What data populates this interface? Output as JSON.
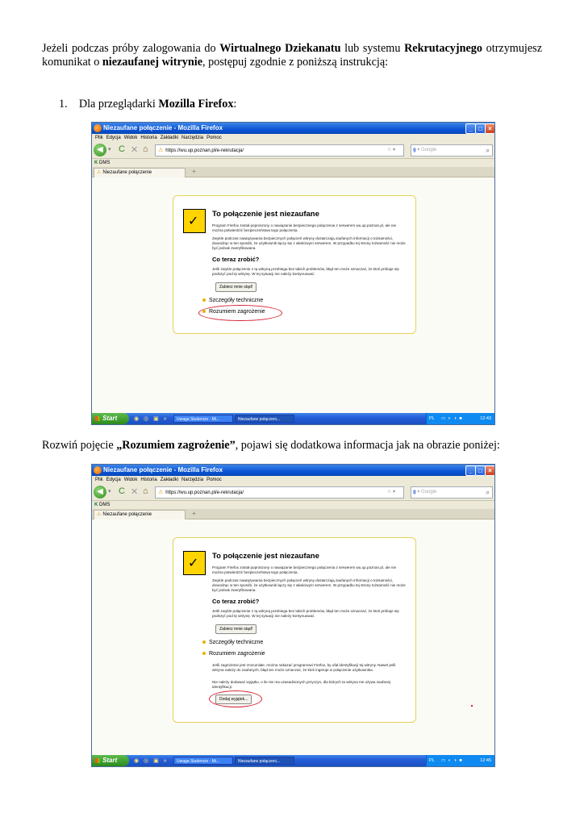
{
  "intro": {
    "t1": "Jeżeli podczas próby zalogowania do ",
    "b1": "Wirtualnego Dziekanatu",
    "t2": " lub systemu ",
    "b2": "Rekrutacyjnego",
    "t3": " otrzymujesz komunikat o ",
    "b3": "niezaufanej witrynie",
    "t4": ", postępuj zgodnie z poniższą instrukcją:"
  },
  "step1": {
    "number": "1.",
    "text": "Dla przeglądarki ",
    "bold": "Mozilla Firefox",
    "suffix": ":"
  },
  "step2": {
    "t1": "Rozwiń pojęcie ",
    "bold": "„Rozumiem zagrożenie”",
    "t2": ", pojawi się dodatkowa informacja jak na obrazie poniżej:"
  },
  "browser": {
    "window_title": "Niezaufane połączenie - Mozilla Firefox",
    "menu": [
      "Plik",
      "Edycja",
      "Widok",
      "Historia",
      "Zakładki",
      "Narzędzia",
      "Pomoc"
    ],
    "url": "https://wu.up.poznan.pl/e-rekrutacja/",
    "search_engine": "Google",
    "bookmark": "DMS",
    "tab_label": "Niezaufane połączenie",
    "newtab": "+",
    "error_title": "To połączenie jest niezaufane",
    "p1": "Program Firefox został poproszony o nawiązanie bezpiecznego połączenia z serwerem wu.up.poznan.pl, ale nie można potwierdzić bezpieczeństwa tego połączenia.",
    "p2": "Zwykle podczas nawiązywania bezpiecznych połączeń witryny dostarczają zaufanych informacji o tożsamości, dowodząc w ten sposób, że użytkownik łączy się z właściwym serwerem. W przypadku tej strony tożsamość nie może być jednak zweryfikowana.",
    "what_now": "Co teraz zrobić?",
    "p3": "Jeśli zwykle połączenie z tą witryną przebiega bez takich problemów, błąd ten może oznaczać, że ktoś próbuje się podszyć pod tę witrynę. W tej sytuacji nie należy kontynuować.",
    "get_me_out": "Zabierz mnie stąd!",
    "tech_details": "Szczegóły techniczne",
    "understand_risks": "Rozumiem zagrożenie",
    "risk_text": "Jeśli zagrożenie jest zrozumiałe, można nakazać programowi Firefox, by ufał identyfikacji tej witryny. Nawet jeśli witryna należy do zaufanych, błąd ten może oznaczać, że ktoś ingeruje w połączenie użytkownika.",
    "risk_text2": "Nie należy dodawać wyjątku, o ile nie ma uzasadnionych przyczyn, dla których ta witryna nie używa zaufanej identyfikacji.",
    "add_exception": "Dodaj wyjątek...",
    "start": "Start",
    "task1": "Uwaga Studencie - Mi...",
    "task2": "Niezaufane połączeni...",
    "lang": "PL",
    "clock1": "12:43",
    "clock2": "12:45"
  },
  "colors": {
    "titlebar": "#0a55d6",
    "highlight_ring": "#d61f2e",
    "shield": "#ffd400"
  }
}
